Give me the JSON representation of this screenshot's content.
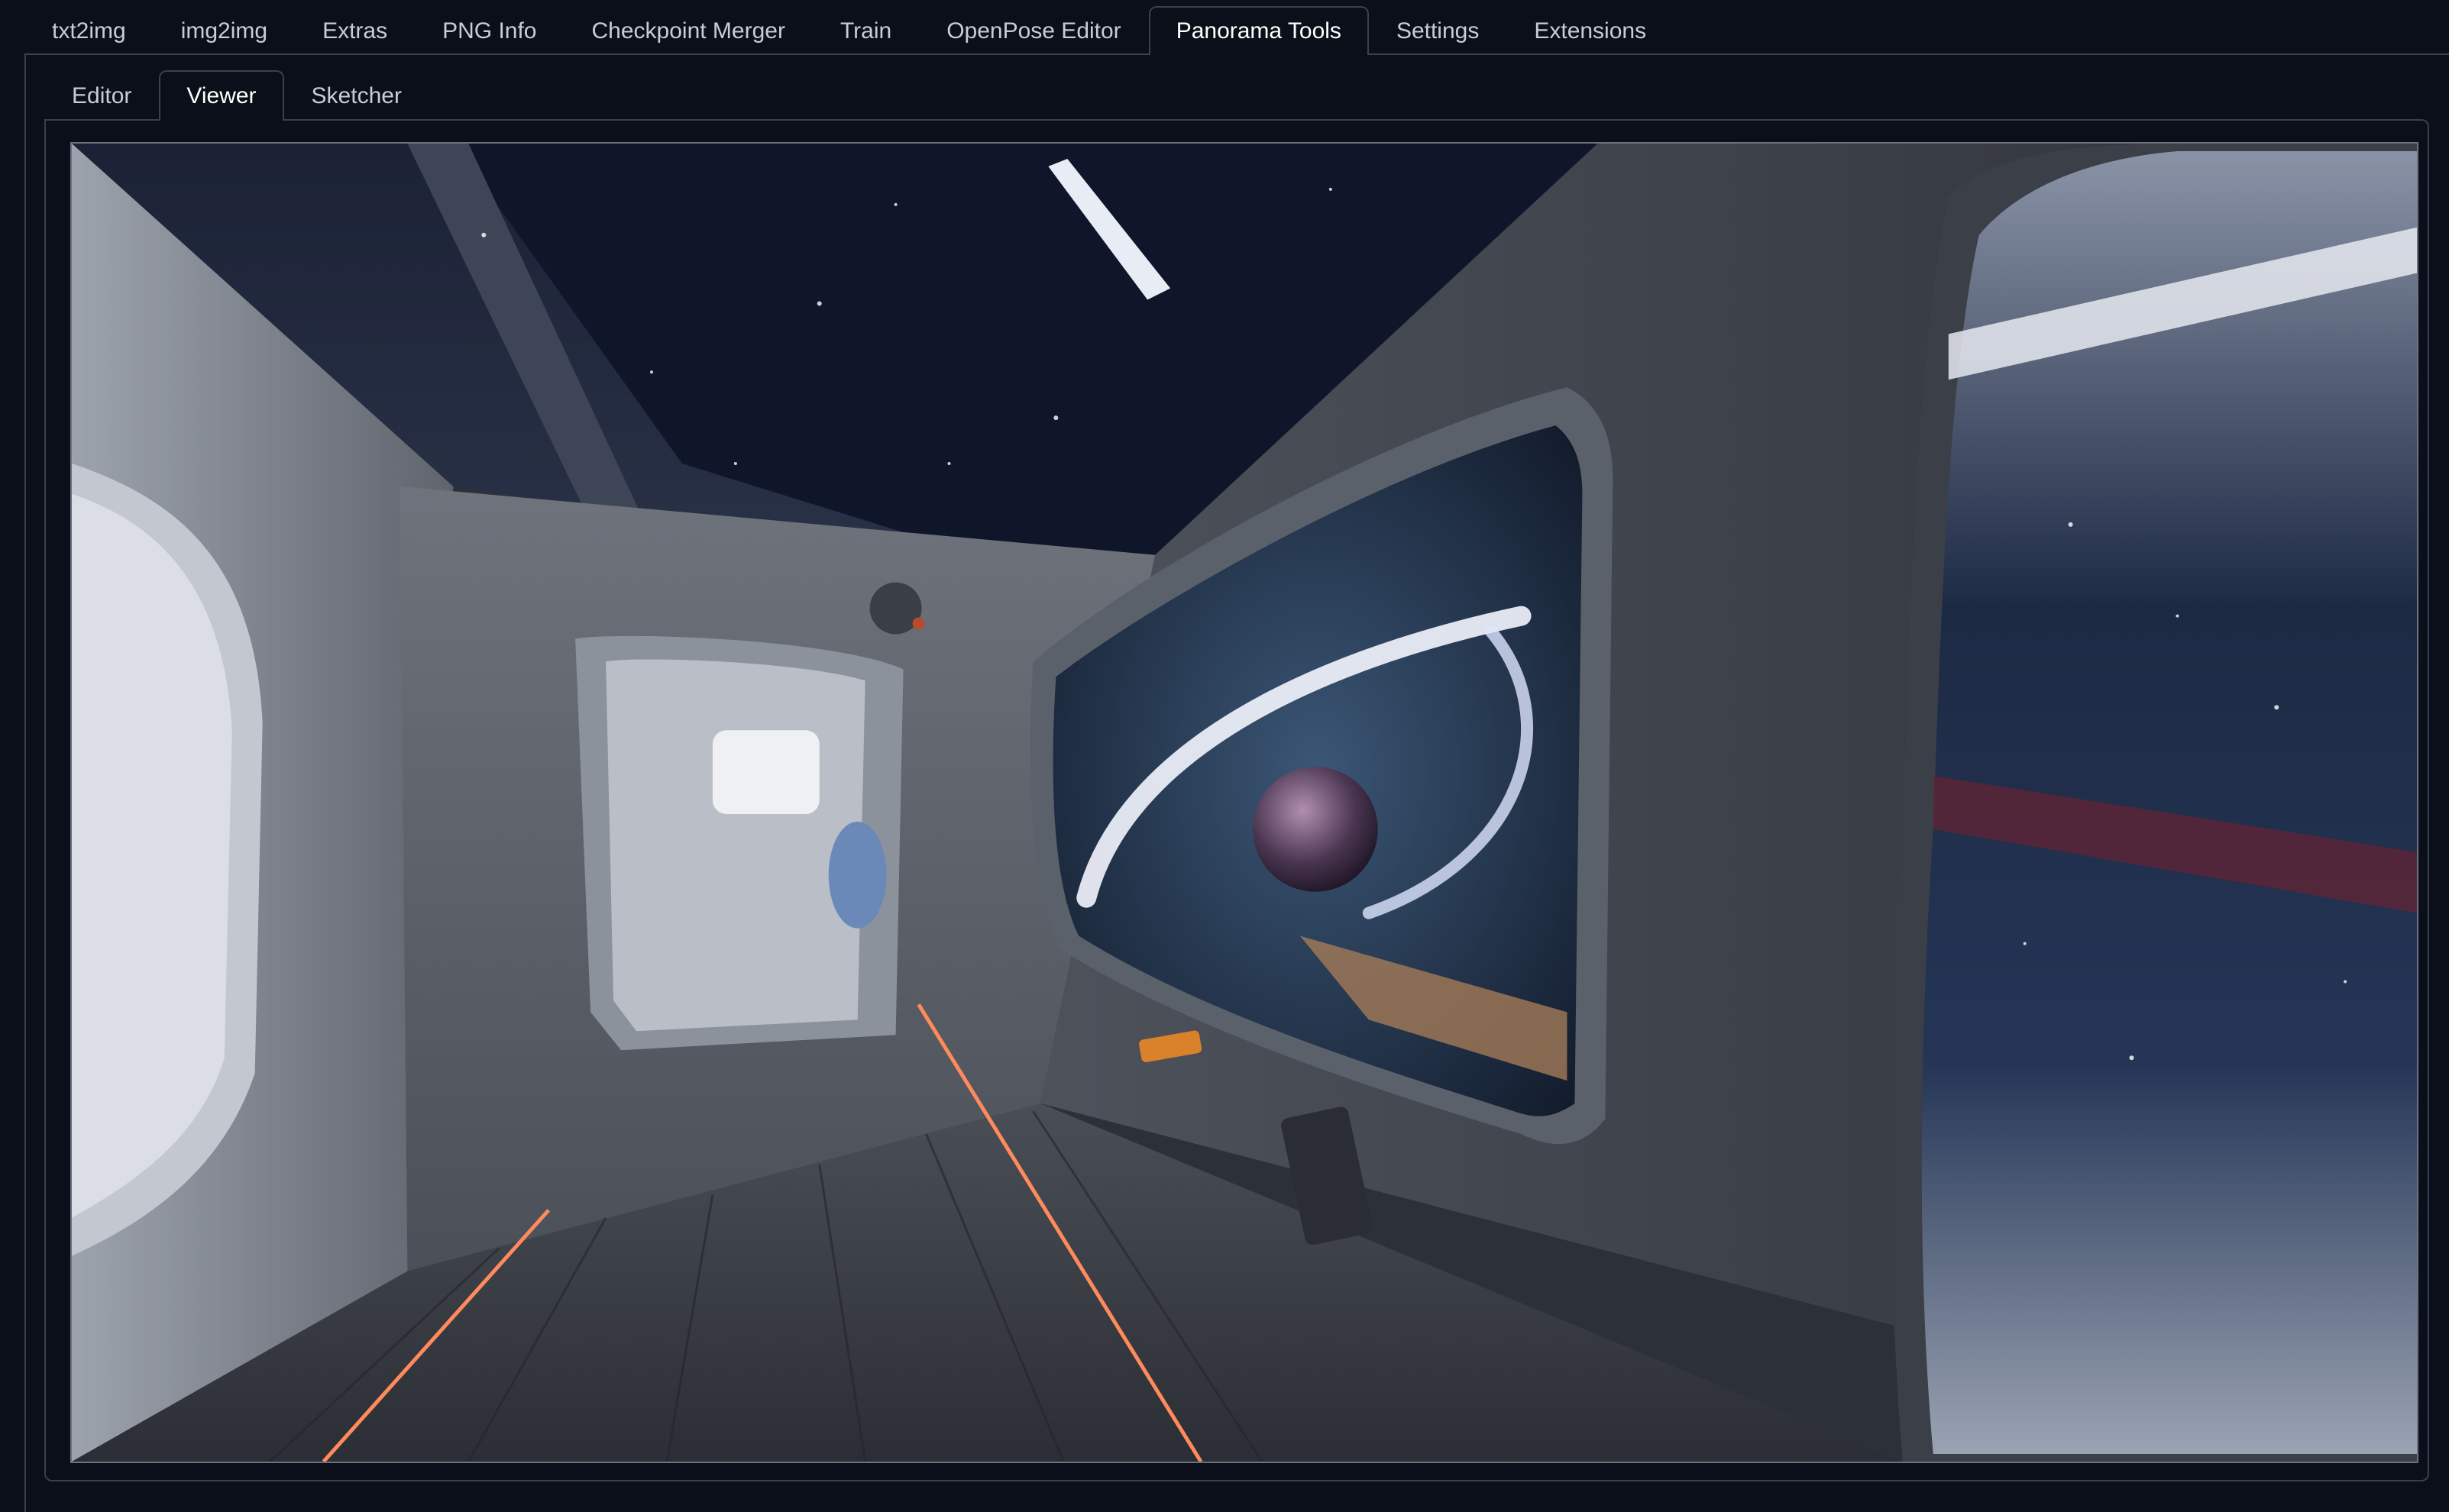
{
  "top_tabs": [
    {
      "label": "txt2img",
      "active": false
    },
    {
      "label": "img2img",
      "active": false
    },
    {
      "label": "Extras",
      "active": false
    },
    {
      "label": "PNG Info",
      "active": false
    },
    {
      "label": "Checkpoint Merger",
      "active": false
    },
    {
      "label": "Train",
      "active": false
    },
    {
      "label": "OpenPose Editor",
      "active": false
    },
    {
      "label": "Panorama Tools",
      "active": true
    },
    {
      "label": "Settings",
      "active": false
    },
    {
      "label": "Extensions",
      "active": false
    }
  ],
  "sub_tabs": [
    {
      "label": "Editor",
      "active": false
    },
    {
      "label": "Viewer",
      "active": true
    },
    {
      "label": "Sketcher",
      "active": false
    }
  ],
  "viewer": {
    "icon": "panorama-360-view",
    "scene": "spaceship-interior-panorama"
  },
  "colors": {
    "background": "#0b0f19",
    "border": "#374151",
    "active_text": "#ffffff",
    "inactive_text": "#c9ccd3",
    "floor_light": "#ff8a5c"
  }
}
